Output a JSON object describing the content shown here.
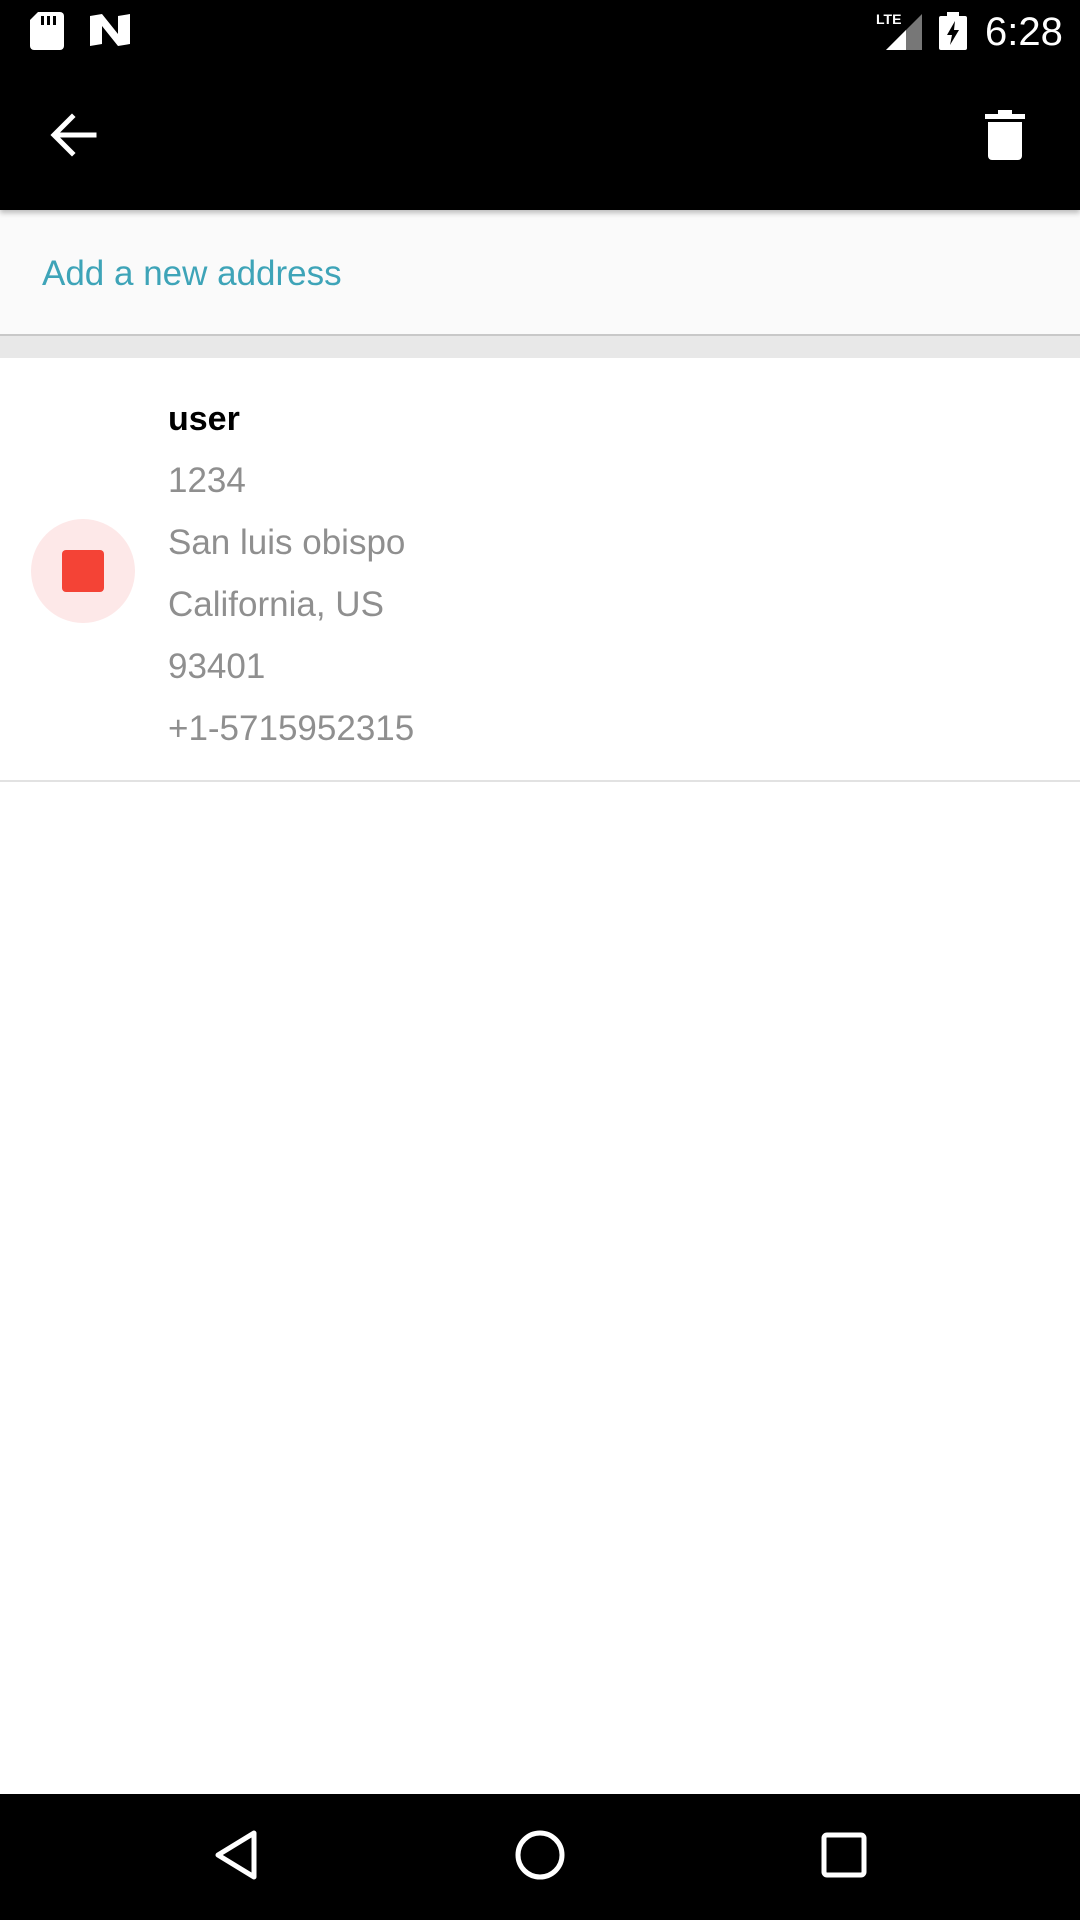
{
  "status_bar": {
    "time": "6:28",
    "network": "LTE",
    "icons": [
      "sd-card-icon",
      "n-notification-icon",
      "lte-signal-icon",
      "battery-charging-icon"
    ]
  },
  "toolbar": {
    "back_icon": "arrow-back-icon",
    "delete_icon": "trash-icon"
  },
  "add_address": {
    "label": "Add a new address",
    "color": "#3ea4b8"
  },
  "address": {
    "selected": true,
    "accent": "#f44336",
    "name": "user",
    "street": "1234",
    "city": "San luis obispo",
    "region": "California, US",
    "zip": "93401",
    "phone": "+1-5715952315"
  },
  "nav_bar": {
    "icons": [
      "nav-back-icon",
      "nav-home-icon",
      "nav-recents-icon"
    ]
  }
}
